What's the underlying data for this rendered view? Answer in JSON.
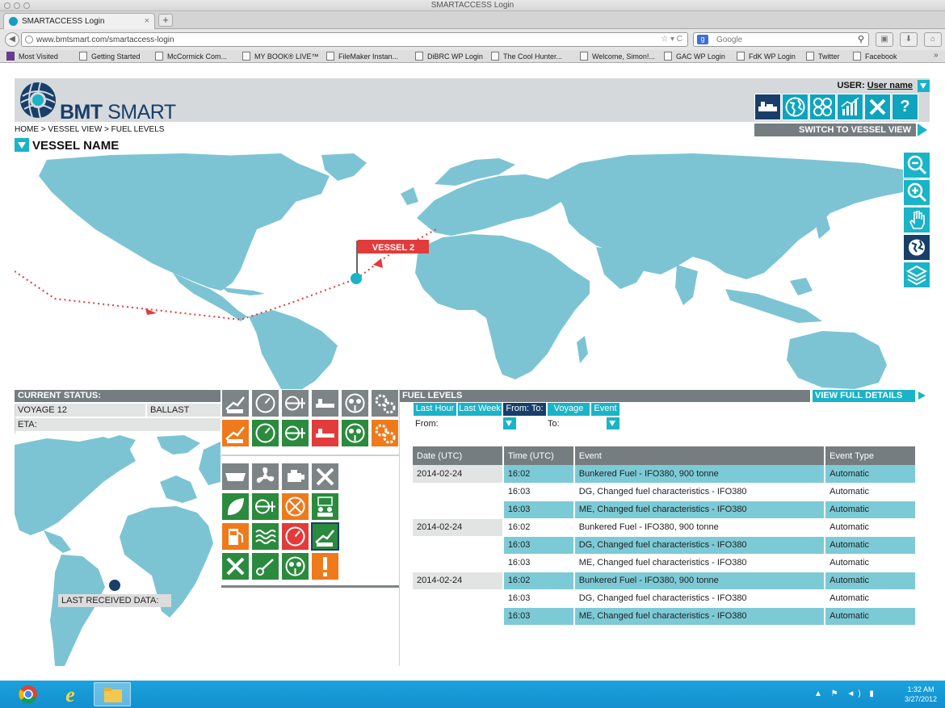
{
  "browser": {
    "window_title": "SMARTACCESS Login",
    "tab_title": "SMARTACCESS Login",
    "new_tab": "+",
    "url": "www.bmtsmart.com/smartaccess-login",
    "search_placeholder": "Google",
    "bookmarks": [
      "Most Visited",
      "Getting Started",
      "McCormick Com...",
      "MY BOOK® LIVE™",
      "FileMaker Instan...",
      "DiBRC WP Login",
      "The Cool Hunter...",
      "Welcome, Simon!...",
      "GAC WP Login",
      "FdK WP Login",
      "Twitter",
      "Facebook"
    ]
  },
  "header": {
    "logo_bold": "BMT",
    "logo_light": " SMART",
    "user_label": "USER:",
    "user_name": "User name",
    "switch_view": "SWITCH TO VESSEL VIEW",
    "help": "?",
    "tools": [
      "vessel-icon",
      "globe-icon",
      "fleet-icon",
      "chart-icon",
      "tools-icon",
      "help-icon"
    ]
  },
  "breadcrumb": "HOME > VESSEL VIEW > FUEL LEVELS",
  "vessel_name": "VESSEL NAME",
  "map": {
    "vessel_label": "VESSEL 2",
    "controls": [
      "zoom-out-icon",
      "zoom-in-icon",
      "pan-hand-icon",
      "globe-icon",
      "layers-icon"
    ]
  },
  "status": {
    "title": "CURRENT STATUS:",
    "voyage": "VOYAGE 12",
    "condition": "BALLAST",
    "eta": "ETA:",
    "last_received": "LAST RECEIVED DATA:"
  },
  "fuel": {
    "title": "FUEL LEVELS",
    "view_full": "VIEW FULL DETAILS",
    "tabs": [
      "Last Hour",
      "Last Week",
      "From: To:",
      "Voyage",
      "Event"
    ],
    "from_label": "From:",
    "to_label": "To:",
    "columns": [
      "Date (UTC)",
      "Time (UTC)",
      "Event",
      "Event Type"
    ],
    "rows": [
      {
        "date": "2014-02-24",
        "time": "16:02",
        "event": "Bunkered Fuel - IFO380, 900 tonne",
        "type": "Automatic"
      },
      {
        "date": "",
        "time": "16:03",
        "event": "DG, Changed fuel characteristics - IFO380",
        "type": "Automatic"
      },
      {
        "date": "",
        "time": "16:03",
        "event": "ME, Changed fuel characteristics - IFO380",
        "type": "Automatic"
      },
      {
        "date": "2014-02-24",
        "time": "16:02",
        "event": "Bunkered Fuel - IFO380, 900 tonne",
        "type": "Automatic"
      },
      {
        "date": "",
        "time": "16:03",
        "event": "DG, Changed fuel characteristics - IFO380",
        "type": "Automatic"
      },
      {
        "date": "",
        "time": "16:03",
        "event": "ME, Changed fuel characteristics - IFO380",
        "type": "Automatic"
      },
      {
        "date": "2014-02-24",
        "time": "16:02",
        "event": "Bunkered Fuel - IFO380, 900 tonne",
        "type": "Automatic"
      },
      {
        "date": "",
        "time": "16:03",
        "event": "DG, Changed fuel characteristics - IFO380",
        "type": "Automatic"
      },
      {
        "date": "",
        "time": "16:03",
        "event": "ME, Changed fuel characteristics - IFO380",
        "type": "Automatic"
      }
    ]
  },
  "taskbar": {
    "time": "1:32 AM",
    "date": "3/27/2012"
  },
  "colors": {
    "teal": "#1ab3c7",
    "navy": "#183f6a",
    "grey": "#757d80",
    "green": "#2b8a3e",
    "orange": "#ee7a1c",
    "red": "#e23b3b",
    "map_land": "#7cc4d3"
  }
}
